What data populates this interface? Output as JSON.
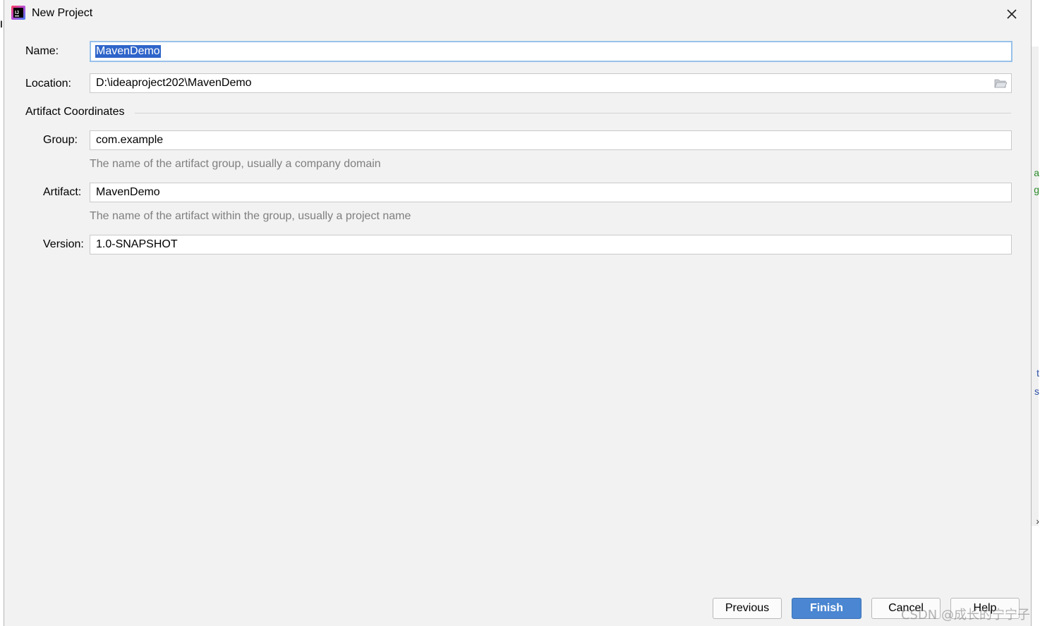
{
  "window": {
    "title": "New Project"
  },
  "name": {
    "label": "Name:",
    "value": "MavenDemo"
  },
  "location": {
    "label": "Location:",
    "value": "D:\\ideaproject202\\MavenDemo"
  },
  "artifact_coordinates": {
    "section_title": "Artifact Coordinates",
    "group": {
      "label": "Group:",
      "value": "com.example",
      "hint": "The name of the artifact group, usually a company domain"
    },
    "artifact": {
      "label": "Artifact:",
      "value": "MavenDemo",
      "hint": "The name of the artifact within the group, usually a project name"
    },
    "version": {
      "label": "Version:",
      "value": "1.0-SNAPSHOT"
    }
  },
  "buttons": {
    "previous": "Previous",
    "finish": "Finish",
    "cancel": "Cancel",
    "help": "Help"
  },
  "watermark": "CSDN @成长的宁宁子",
  "colors": {
    "accent": "#4a86d1",
    "focus_border": "#98c1ea",
    "selection": "#2f65ca",
    "dialog_bg": "#f2f2f2"
  }
}
